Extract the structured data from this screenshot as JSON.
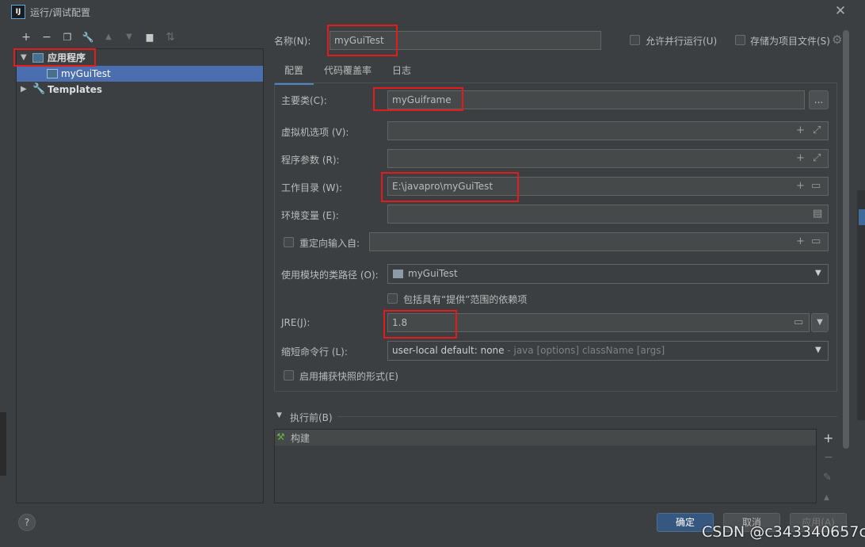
{
  "window": {
    "title": "运行/调试配置",
    "app_icon": "IJ",
    "close": "✕"
  },
  "toolbar_left": [
    {
      "name": "add-icon",
      "glyph": "+"
    },
    {
      "name": "remove-icon",
      "glyph": "−"
    },
    {
      "name": "copy-icon",
      "glyph": "❐"
    },
    {
      "name": "wrench-icon",
      "glyph": "🔧"
    },
    {
      "name": "move-up-icon",
      "glyph": "▲"
    },
    {
      "name": "move-down-icon",
      "glyph": "▼"
    },
    {
      "name": "folder-add-icon",
      "glyph": "▆"
    },
    {
      "name": "sort-icon",
      "glyph": "⇅"
    }
  ],
  "tree": {
    "group_label": "应用程序",
    "item_label": "myGuiTest",
    "templates_label": "Templates"
  },
  "header": {
    "name_label": "名称(N):",
    "name_value": "myGuiTest",
    "parallel_label": "允许并行运行(U)",
    "store_label": "存储为项目文件(S)"
  },
  "tabs": [
    "配置",
    "代码覆盖率",
    "日志"
  ],
  "form": {
    "main_class_label": "主要类(C):",
    "main_class_value": "myGuiframe",
    "browse_label": "...",
    "vm_label": "虚拟机选项 (V):",
    "args_label": "程序参数 (R):",
    "workdir_label": "工作目录 (W):",
    "workdir_value": "E:\\javapro\\myGuiTest",
    "env_label": "环境变量 (E):",
    "redirect_label": "重定向输入自:",
    "module_label": "使用模块的类路径 (O):",
    "module_value": "myGuiTest",
    "include_label": "包括具有“提供”范围的依赖项",
    "jre_label": "JRE(J):",
    "jre_value": "1.8",
    "shorten_label": "缩短命令行 (L):",
    "shorten_value": "user-local default: none",
    "shorten_hint": " - java [options] className [args]",
    "snapshot_label": "启用捕获快照的形式(E)"
  },
  "before": {
    "section_label": "执行前(B)",
    "build_label": "构建"
  },
  "footer": {
    "help": "?",
    "ok_label": "确定",
    "cancel_label": "取消",
    "apply_label": "应用(A)"
  },
  "watermark": "CSDN @c343340657c",
  "colors": {
    "accent": "#4b6eaf",
    "highlight_box": "#e31b1b",
    "primary_button": "#365880"
  }
}
